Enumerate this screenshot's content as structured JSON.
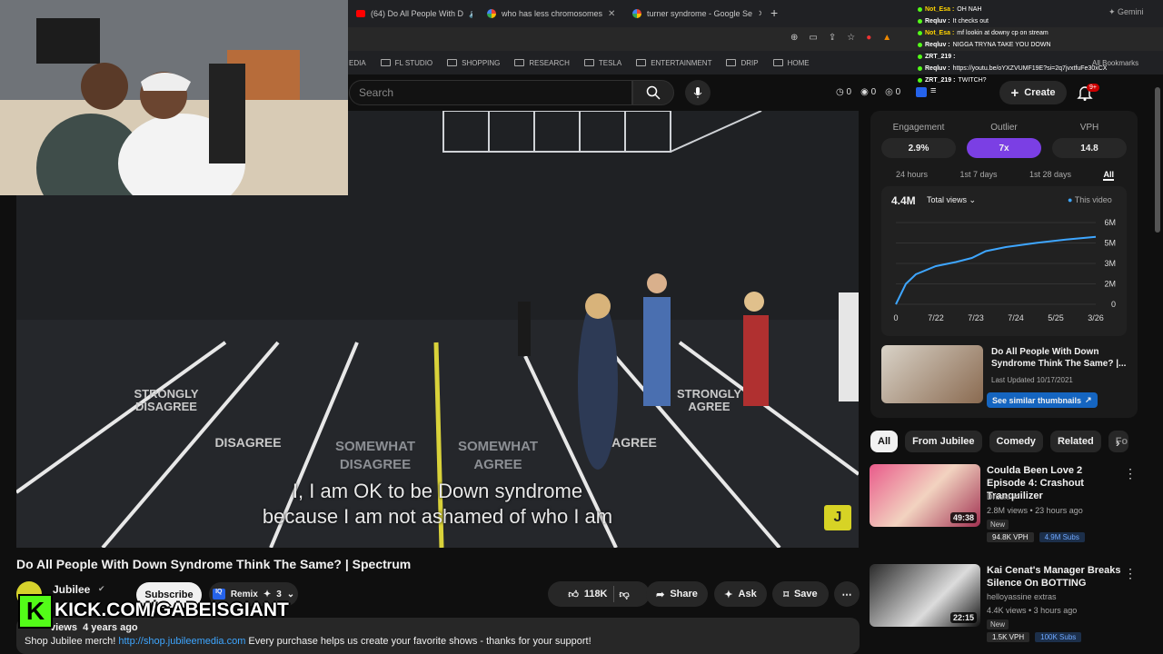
{
  "browser": {
    "tabs": [
      {
        "title": "(64) Do All People With D"
      },
      {
        "title": "who has less chromosomes"
      },
      {
        "title": "turner syndrome - Google Se"
      }
    ],
    "gemini_label": "Gemini",
    "bookmarks": [
      "EDIA",
      "FL STUDIO",
      "SHOPPING",
      "RESEARCH",
      "TESLA",
      "ENTERTAINMENT",
      "DRIP",
      "HOME"
    ],
    "all_bookmarks": "All Bookmarks"
  },
  "chat": [
    {
      "user": "Not_Esa",
      "msg": "OH NAH",
      "color": "#ffd400"
    },
    {
      "user": "Reqluv",
      "msg": "It checks out",
      "color": "#ffffff"
    },
    {
      "user": "Not_Esa",
      "msg": "mf lookin at downy cp on stream",
      "color": "#ffd400"
    },
    {
      "user": "Reqluv",
      "msg": "NIGGA TRYNA TAKE YOU DOWN",
      "color": "#ffffff"
    },
    {
      "user": "ZRT_219",
      "msg": "",
      "color": "#ffffff"
    },
    {
      "user": "Reqluv",
      "msg": "https://youtu.be/oYXZVUMF19E?si=2q7jvxtfuFe30xCX",
      "color": "#ffffff"
    },
    {
      "user": "ZRT_219",
      "msg": "TWITCH?",
      "color": "#ffffff"
    }
  ],
  "header": {
    "search_placeholder": "Search",
    "stats": [
      "0",
      "0",
      "0"
    ],
    "create_label": "Create",
    "notif_count": "9+"
  },
  "video": {
    "zones": [
      "STRONGLY DISAGREE",
      "DISAGREE",
      "SOMEWHAT DISAGREE",
      "SOMEWHAT AGREE",
      "AGREE",
      "STRONGLY AGREE"
    ],
    "subtitle_line1": "I, I am OK to be Down syndrome",
    "subtitle_line2": "because I am not ashamed of who I am",
    "title": "Do All People With Down Syndrome Think The Same? | Spectrum"
  },
  "channel": {
    "name": "Jubilee",
    "subscribe_label": "Subscribe",
    "remix_label": "Remix",
    "remix_count": "3",
    "likes": "118K",
    "share_label": "Share",
    "ask_label": "Ask",
    "save_label": "Save"
  },
  "overlay": {
    "kick_text": "KICK.COM/GABEISGIANT"
  },
  "description": {
    "views": "views",
    "age": "4 years ago",
    "text_before": "Shop Jubilee merch! ",
    "link": "http://shop.jubileemedia.com",
    "text_after": " Every purchase helps us create your favorite shows - thanks for your support!"
  },
  "panel": {
    "metrics": [
      {
        "label": "Engagement",
        "value": "2.9%"
      },
      {
        "label": "Outlier",
        "value": "7x"
      },
      {
        "label": "VPH",
        "value": "14.8"
      }
    ],
    "ranges": [
      "24 hours",
      "1st 7 days",
      "1st 28 days",
      "All"
    ],
    "total": "4.4M",
    "metric_select": "Total views",
    "legend": "This video",
    "related_title": "Do All People With Down Syndrome Think The Same? |...",
    "related_updated": "Last Updated 10/17/2021",
    "similar_label": "See similar thumbnails"
  },
  "chart_data": {
    "type": "line",
    "x": [
      "7/22",
      "7/23",
      "7/24",
      "5/25",
      "3/26"
    ],
    "x_first_label": "0",
    "yticks": [
      "0",
      "2M",
      "3M",
      "5M",
      "6M"
    ],
    "ylim": [
      0,
      6
    ],
    "series": [
      {
        "name": "This video",
        "points": [
          [
            0,
            0
          ],
          [
            0.05,
            1.5
          ],
          [
            0.1,
            2.2
          ],
          [
            0.2,
            2.8
          ],
          [
            0.3,
            3.1
          ],
          [
            0.38,
            3.4
          ],
          [
            0.45,
            3.9
          ],
          [
            0.55,
            4.2
          ],
          [
            0.7,
            4.5
          ],
          [
            0.85,
            4.75
          ],
          [
            1.0,
            4.95
          ]
        ]
      }
    ],
    "color": "#3ea6ff"
  },
  "chips": [
    "All",
    "From Jubilee",
    "Comedy",
    "Related",
    "Fo"
  ],
  "recommendations": [
    {
      "title": "Coulda Been Love 2 Episode 4: Crashout Tranquilizer",
      "channel": "Druski",
      "meta": "2.8M views • 23 hours ago",
      "duration": "49:38",
      "badge": "New",
      "vph": "94.8K VPH",
      "subs": "4.9M Subs"
    },
    {
      "title": "Kai Cenat's Manager Breaks Silence On BOTTING",
      "channel": "helloyassine extras",
      "meta": "4.4K views • 3 hours ago",
      "duration": "22:15",
      "badge": "New",
      "vph": "1.5K VPH",
      "subs": "100K Subs"
    }
  ]
}
